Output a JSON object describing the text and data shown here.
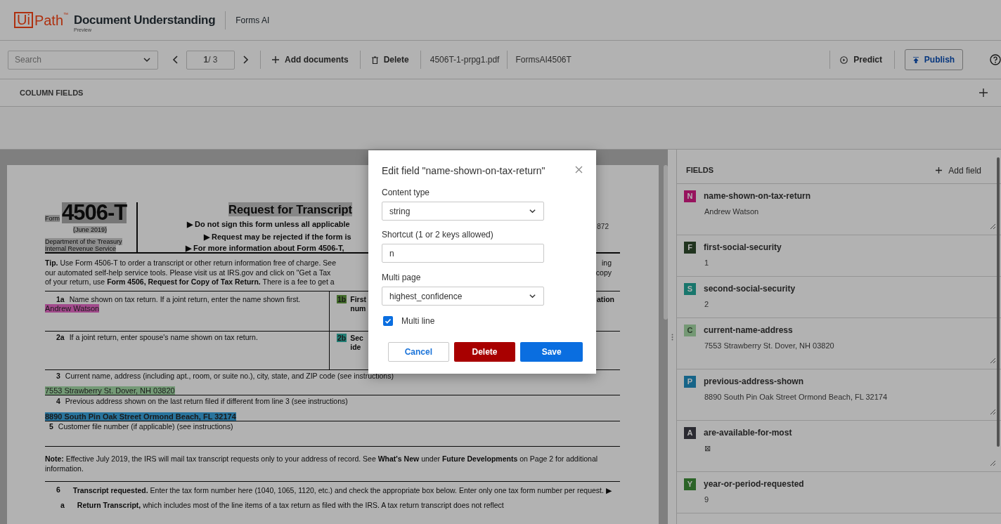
{
  "header": {
    "logo_ui": "Ui",
    "logo_path": "Path",
    "logo_tm": "™",
    "product": "Document Understanding",
    "product_badge": "Preview",
    "project": "Forms AI"
  },
  "toolbar": {
    "search": {
      "placeholder": "Search"
    },
    "page": "**1**/ 3",
    "add_documents": "Add documents",
    "delete": "Delete",
    "file_name": "4506T-1-prpg1.pdf",
    "model_name": "FormsAI4506T",
    "predict": "Predict",
    "publish": "Publish"
  },
  "column_fields": {
    "title": "COLUMN FIELDS"
  },
  "document": {
    "form_label": "Form",
    "form_number": "4506-T",
    "form_date": "(June 2019)",
    "agency": [
      "Department of the Treasury",
      "Internal Revenue Service"
    ],
    "title": "Request for Transcript",
    "omb": "872",
    "instructions": [
      {
        "arrow": "▶",
        "text": "Do not sign this form unless all applicable"
      },
      {
        "arrow": "▶",
        "text": "Request may be rejected if the form is"
      },
      {
        "arrow": "▶",
        "text": "For more information about Form 4506-T,"
      }
    ],
    "tip_lines": [
      {
        "text": "**Tip.** Use Form 4506-T to order a transcript or other return information free of charge. See",
        "tail": "ing"
      },
      {
        "text": "our automated self-help service tools. Please visit us at IRS.gov and click on \"Get a Tax",
        "tail": "copy"
      },
      {
        "text": "of your return, use **Form 4506, Request for Copy of Tax Return.** There is a fee to get a"
      }
    ],
    "line_1a": {
      "number": "1a",
      "label": "Name shown on tax return. If a joint return, enter the name shown first.",
      "extraction": {
        "text": "Andrew Watson",
        "color": "#a24a8c"
      }
    },
    "line_1b": {
      "number": "1b",
      "color": "#436c2a",
      "lines": [
        "First",
        "num"
      ],
      "tail": "ation"
    },
    "line_2a": {
      "number": "2a",
      "label": "If a joint return, enter spouse's name shown on tax return."
    },
    "line_2b": {
      "number": "2b",
      "color": "#217d74",
      "lines": [
        "Sec",
        "ide"
      ]
    },
    "line_3": {
      "number": "3",
      "label": "Current name, address (including apt., room, or suite no.), city, state, and ZIP code (see instructions)",
      "extraction": {
        "text": "7553 Strawberry St. Dover, NH 03820",
        "color": "#749a76"
      }
    },
    "line_4": {
      "number": "4",
      "label": "Previous address shown on the last return filed if different from line 3 (see instructions)",
      "extraction": {
        "text": "8890 South Pin Oak Street Ormond Beach, FL 32174",
        "color": "#29749d"
      }
    },
    "line_5": {
      "number": "5",
      "label": "Customer file number (if applicable) (see instructions)"
    },
    "note": "**Note:** Effective July 2019, the IRS will mail tax transcript requests only to your address of record. See **What's New** under **Future Developments** on Page 2 for additional information.",
    "line_6": {
      "number": "6",
      "label": "**Transcript requested.** Enter the tax form number here (1040, 1065, 1120, etc.) and check the appropriate box below. Enter only one tax form number per request. ▶"
    },
    "line_6a": {
      "number": "a",
      "label": "**Return Transcript,** which includes most of the line items of a tax return as filed with the IRS. A tax return transcript does not reflect"
    }
  },
  "fields_panel": {
    "title": "FIELDS",
    "add_field": "Add field",
    "items": [
      {
        "letter": "N",
        "color": "#97135e",
        "name": "name-shown-on-tax-return",
        "value": "Andrew Watson",
        "multiline": true
      },
      {
        "letter": "F",
        "color": "#21341f",
        "name": "first-social-security",
        "value": "1",
        "multiline": false
      },
      {
        "letter": "S",
        "color": "#18766c",
        "name": "second-social-security",
        "value": "2",
        "multiline": false
      },
      {
        "letter": "C",
        "color": "#749874",
        "name": "current-name-address",
        "value": "7553 Strawberry St. Dover, NH 03820",
        "multiline": true
      },
      {
        "letter": "P",
        "color": "#166488",
        "name": "previous-address-shown",
        "value": "8890 South Pin Oak Street Ormond Beach, FL 32174",
        "multiline": true
      },
      {
        "letter": "A",
        "color": "#2b2b32",
        "name": "are-available-for-most",
        "value": "⊠",
        "multiline": true
      },
      {
        "letter": "Y",
        "color": "#2b6327",
        "name": "year-or-period-requested",
        "value": "9",
        "multiline": false
      }
    ]
  },
  "dialog": {
    "title": "Edit field \"name-shown-on-tax-return\"",
    "content_type": {
      "label": "Content type",
      "value": "string"
    },
    "shortcut": {
      "label": "Shortcut (1 or 2 keys allowed)",
      "value": "n"
    },
    "multi_page": {
      "label": "Multi page",
      "value": "highest_confidence"
    },
    "multi_line": {
      "label": "Multi line",
      "checked": true
    },
    "cancel": "Cancel",
    "delete": "Delete",
    "save": "Save"
  }
}
